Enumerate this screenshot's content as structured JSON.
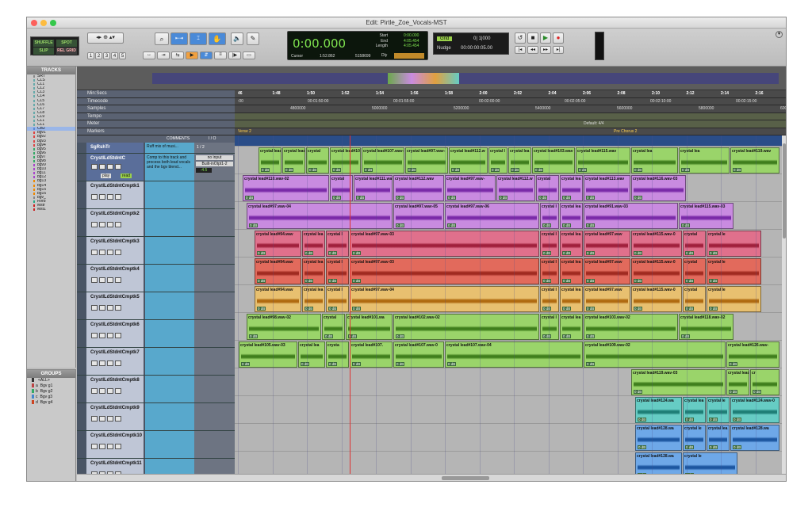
{
  "window": {
    "title": "Edit: Pirtle_Zoe_Vocals-MST"
  },
  "modes": {
    "shuffle": "SHUFFLE",
    "spot": "SPOT",
    "slip": "SLIP",
    "grid": "REL GRID"
  },
  "zoom_presets": [
    "1",
    "2",
    "3",
    "4",
    "5"
  ],
  "counter": {
    "main": "0:00.000",
    "start_label": "Start",
    "end_label": "End",
    "length_label": "Length",
    "start": "0:00.000",
    "end": "4:05.454",
    "length": "4:05.454",
    "cursor_label": "Cursor",
    "cursor": "1:52.862",
    "sample": "5158699",
    "dly": "Dly"
  },
  "grid": {
    "label": "Grid",
    "value": "0| 1|000",
    "nudge_label": "Nudge",
    "nudge_value": "00:00:00:05.00"
  },
  "tracks_panel": {
    "title": "TRACKS",
    "items": [
      "SRT",
      "CLS",
      "CL1",
      "CL2",
      "CL3",
      "CL4",
      "CL5",
      "CL6",
      "CL7",
      "CL8",
      "CL9",
      "CL1",
      "CL1",
      "CB2",
      "bgv1",
      "bgv2",
      "bgv3",
      "bgv4",
      "bgv5",
      "bgv6",
      "bgv7",
      "bgv8",
      "bgv9",
      "bg10",
      "bg11",
      "bg12",
      "bg13",
      "bg14",
      "bg15",
      "bg16",
      "bgv_",
      "Rvrb",
      "Mstr",
      "Mst1"
    ]
  },
  "groups_panel": {
    "title": "GROUPS",
    "items": [
      {
        "id": "",
        "name": "<ALL>"
      },
      {
        "id": "a",
        "name": "Bgv g1"
      },
      {
        "id": "b",
        "name": "Bgv g2"
      },
      {
        "id": "c",
        "name": "Bgv g3"
      },
      {
        "id": "d",
        "name": "Bgv g4"
      }
    ]
  },
  "rulers": {
    "rows": [
      "Min:Secs",
      "Timecode",
      "Samples",
      "Tempo",
      "Meter",
      "Markers"
    ],
    "minsecs": [
      "46",
      "1:48",
      "1:50",
      "1:52",
      "1:54",
      "1:56",
      "1:58",
      "2:00",
      "2:02",
      "2:04",
      "2:06",
      "2:08",
      "2:10",
      "2:12",
      "2:14",
      "2:16"
    ],
    "timecode": [
      ":00",
      "00:01:50:00",
      "00:01:55:00",
      "00:02:00:00",
      "00:02:05:00",
      "00:02:10:00",
      "00:02:15:00"
    ],
    "samples": [
      "4800000",
      "5000000",
      "5200000",
      "5400000",
      "5600000",
      "5800000",
      "6000000"
    ],
    "meter": "Default: 4/4",
    "markers": [
      "Verse 2",
      "Pre Chorus 2"
    ]
  },
  "header_cols": {
    "comments": "COMMENTS",
    "io": "I / O"
  },
  "tracks": [
    {
      "name": "SgRshTr",
      "comment": "Ruff mix of musi...",
      "io": "1 / 2"
    },
    {
      "name": "CrystlLdStdntC",
      "comment": "Comp to this track and process both lead vocals and the bgv blend...",
      "io_in": "no input",
      "io_out": "Built-inOtpt1-2",
      "vol": "-4.5",
      "play": "play",
      "read": "read"
    },
    {
      "name": "CrystlLdStdntCmptk1"
    },
    {
      "name": "CrystlLdStdntCmptk2"
    },
    {
      "name": "CrystlLdStdntCmptk3"
    },
    {
      "name": "CrystlLdStdntCmptk4"
    },
    {
      "name": "CrystlLdStdntCmptk5"
    },
    {
      "name": "CrystlLdStdntCmptk6"
    },
    {
      "name": "CrystlLdStdntCmptk7"
    },
    {
      "name": "CrystlLdStdntCmptk8"
    },
    {
      "name": "CrystlLdStdntCmptk9"
    },
    {
      "name": "CrystlLdStdntCmptk10"
    },
    {
      "name": "CrystlLdStdntCmptk11"
    }
  ],
  "clip_db": "0 dB",
  "lanes": [
    {
      "color": "#9ad46a",
      "clips": [
        "crystal lead#105.w",
        "crystal lead",
        "crystal",
        "crystal lead#101.w",
        "crystal lead#107.wav-05",
        "crystal lead#97.wav-",
        "crystal lead#112.w",
        "crystal l",
        "crystal lea",
        "crystal lead#103.wav",
        "crystal lead#115.wav",
        "crystal lea",
        "crystal lea",
        "crystal lead#119.wav"
      ]
    },
    {
      "color": "#c98be0",
      "clips": [
        "crystal lead#110.wav-02",
        "crystal",
        "crystal lead#111.wa",
        "crystal lead#112.wav",
        "crystal lead#97.wav-",
        "crystal lead#112.w",
        "crystal",
        "crystal lea",
        "crystal lead#113.wav",
        "crystal lead#116.wav-03"
      ]
    },
    {
      "color": "#c98be0",
      "clips": [
        "crystal lead#97.wav-04",
        "crystal lead#97.wav-05",
        "crystal lead#97.wav-06",
        "crystal l",
        "crystal lea",
        "crystal lead#91.wav-03",
        "crystal lead#115.wav-03"
      ]
    },
    {
      "color": "#e0708c",
      "clips": [
        "crystal lead#94.wav",
        "crystal lea",
        "crystal l",
        "crystal lead#97.wav-03",
        "crystal l",
        "crystal lea",
        "crystal lead#97.wav",
        "crystal lead#115.wav-0",
        "crystal",
        "crystal le"
      ]
    },
    {
      "color": "#e26a5c",
      "clips": [
        "crystal lead#94.wav",
        "crystal lea",
        "crystal l",
        "crystal lead#97.wav-03",
        "crystal l",
        "crystal lea",
        "crystal lead#97.wav",
        "crystal lead#115.wav-0",
        "crystal",
        "crystal le"
      ]
    },
    {
      "color": "#e8c070",
      "clips": [
        "crystal lead#94.wav",
        "crystal lea",
        "crystal l",
        "crystal lead#97.wav-04",
        "crystal l",
        "crystal lea",
        "crystal lead#97.wav",
        "crystal lead#115.wav-0",
        "crystal",
        "crystal le"
      ]
    },
    {
      "color": "#9ad46a",
      "clips": [
        "crystal lead#98.wav-02",
        "crystal",
        "crystal lead#101.wa",
        "crystal lead#102.wav-02",
        "crystal l",
        "crystal lea",
        "crystal lead#103.wav-02",
        "crystal lead#118.wav-02"
      ]
    },
    {
      "color": "#9ad46a",
      "clips": [
        "crystal lead#105.wav-03",
        "crystal lea",
        "crysta",
        "crystal lead#107.",
        "crystal lead#107.wav-0",
        "crystal lead#107.wav-04",
        "crystal lead#109.wav-02",
        "crystal lead#126.wav-"
      ]
    },
    {
      "color": "#9ad46a",
      "clips": [
        "crystal lead#119.wav-03",
        "crystal lead#110.wa",
        "cr"
      ]
    },
    {
      "color": "#66ccc4",
      "clips": [
        "crystal lead#124.wa",
        "crystal lea",
        "crystal le",
        "crystal lead#124.wav-0"
      ]
    },
    {
      "color": "#6ea8e8",
      "clips": [
        "crystal lead#128.wa",
        "crystal le",
        "crystal lea",
        "crystal lead#128.wa"
      ]
    },
    {
      "color": "#6ea8e8",
      "clips": [
        "crystal lead#128.wa",
        "crystal le"
      ]
    }
  ]
}
